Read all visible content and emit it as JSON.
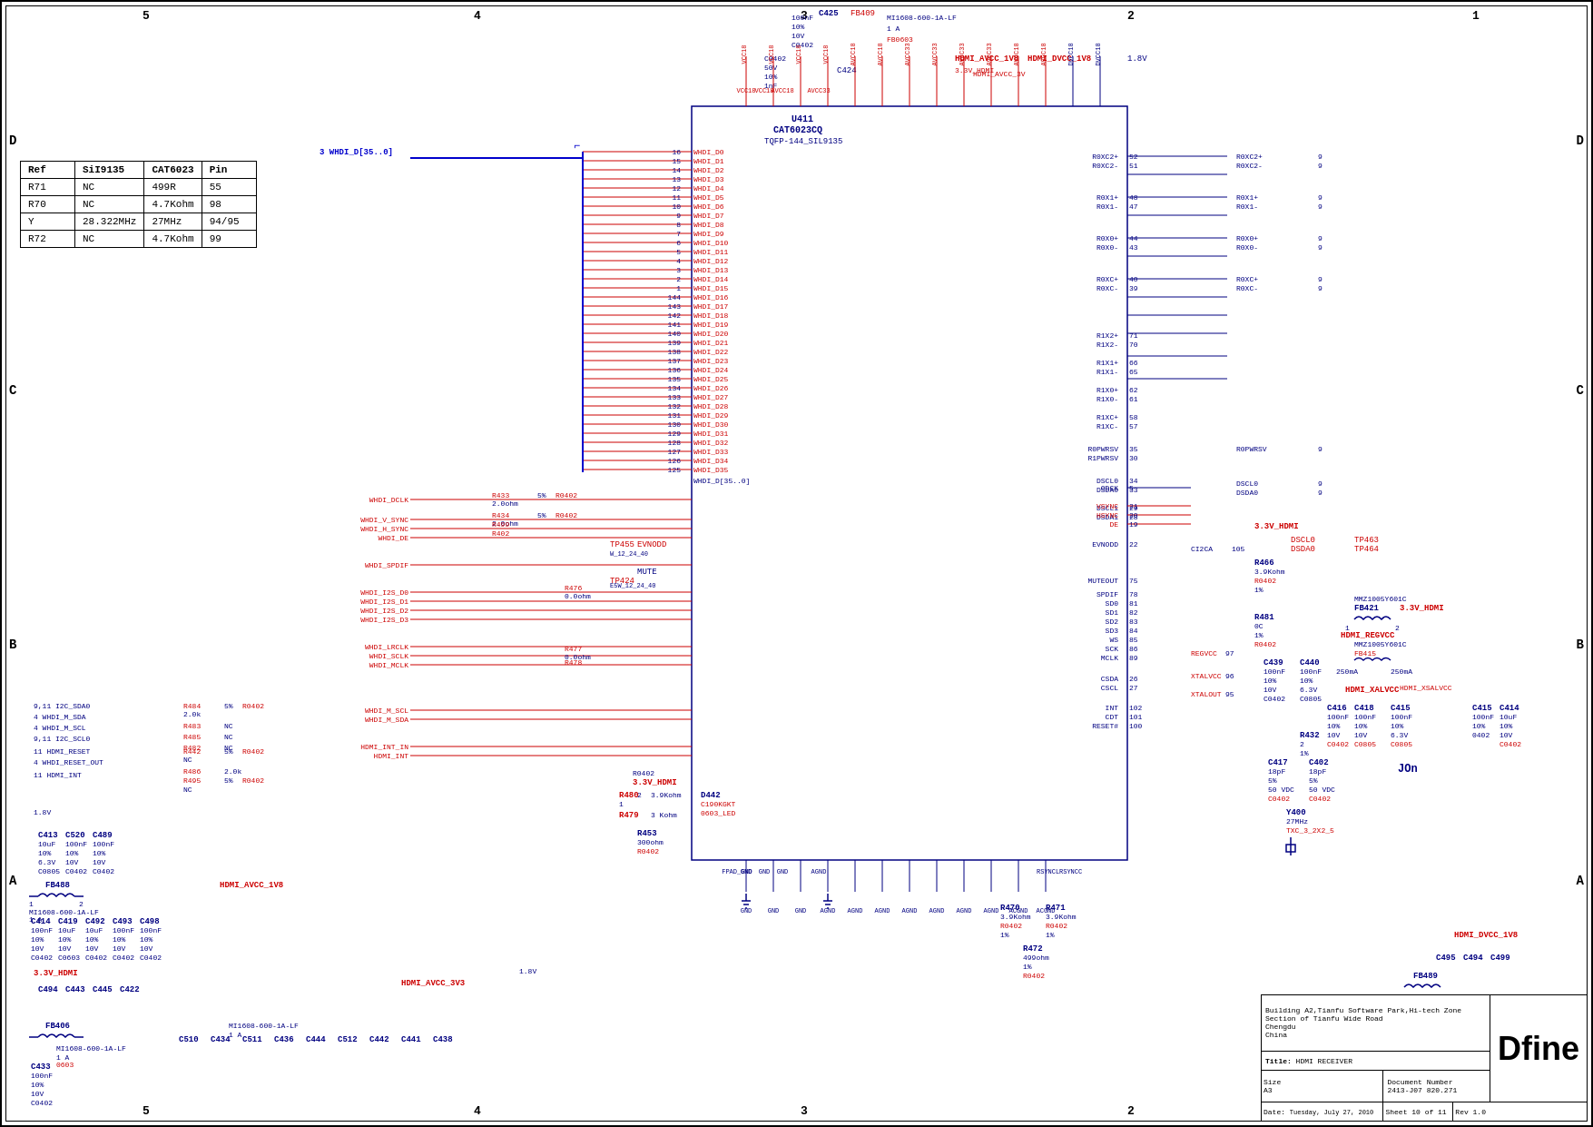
{
  "schematic": {
    "title": "HDMI RECEIVER",
    "sheet": "10",
    "of": "11",
    "rev": "1.0",
    "size": "A3",
    "doc_number": "2413-J07 820.271",
    "date": "Tuesday, July 27, 2010",
    "company": "Dfine",
    "address1": "Building A2,Tianfu Software Park,Hi-tech Zone",
    "address2": "Section of Tianfu Wide Road",
    "city": "Chengdu",
    "country": "China"
  },
  "border": {
    "col_labels": [
      "5",
      "4",
      "3",
      "2",
      "1"
    ],
    "row_labels": [
      "D",
      "C",
      "B",
      "A"
    ]
  },
  "comp_table": {
    "headers": [
      "Ref",
      "SiI9135",
      "CAT6023",
      "Pin"
    ],
    "rows": [
      [
        "R71",
        "NC",
        "499R",
        "55"
      ],
      [
        "R70",
        "NC",
        "4.7Kohm",
        "98"
      ],
      [
        "Y",
        "28.322MHz",
        "27MHz",
        "94/95"
      ],
      [
        "R72",
        "NC",
        "4.7Kohm",
        "99"
      ]
    ]
  },
  "ic": {
    "ref": "U411",
    "part": "CAT6023CQ",
    "package": "TQFP-144_SIL9135"
  },
  "signals": {
    "whdi_data": [
      "WHDI_D0",
      "WHDI_D1",
      "WHDI_D2",
      "WHDI_D3",
      "WHDI_D4",
      "WHDI_D5",
      "WHDI_D6",
      "WHDI_D7",
      "WHDI_D8",
      "WHDI_D9",
      "WHDI_D10",
      "WHDI_D11",
      "WHDI_D12",
      "WHDI_D13",
      "WHDI_D14",
      "WHDI_D15",
      "WHDI_D16",
      "WHDI_D17",
      "WHDI_D18",
      "WHDI_D19",
      "WHDI_D20",
      "WHDI_D21",
      "WHDI_D22",
      "WHDI_D23",
      "WHDI_D24",
      "WHDI_D25",
      "WHDI_D26",
      "WHDI_D27",
      "WHDI_D28",
      "WHDI_D29",
      "WHDI_D30",
      "WHDI_D31",
      "WHDI_D32",
      "WHDI_D33",
      "WHDI_D34",
      "WHDI_D35"
    ],
    "misc": [
      "ODCK",
      "VSYNC",
      "HSYNC",
      "DE",
      "EVNODD",
      "MUTEOUT",
      "SPDIF",
      "SD0",
      "SD1",
      "SD2",
      "SD3",
      "WS",
      "SCK",
      "MCLK",
      "CSDA",
      "CSCL",
      "INT",
      "CDT",
      "RESET#"
    ],
    "power": [
      "HDMI_AVCC_1V8",
      "HDMI_DVCC_1V8",
      "3.3V_HDMI",
      "HDMI_AVCC_3V",
      "HDMI_AVCC_3V3"
    ]
  }
}
